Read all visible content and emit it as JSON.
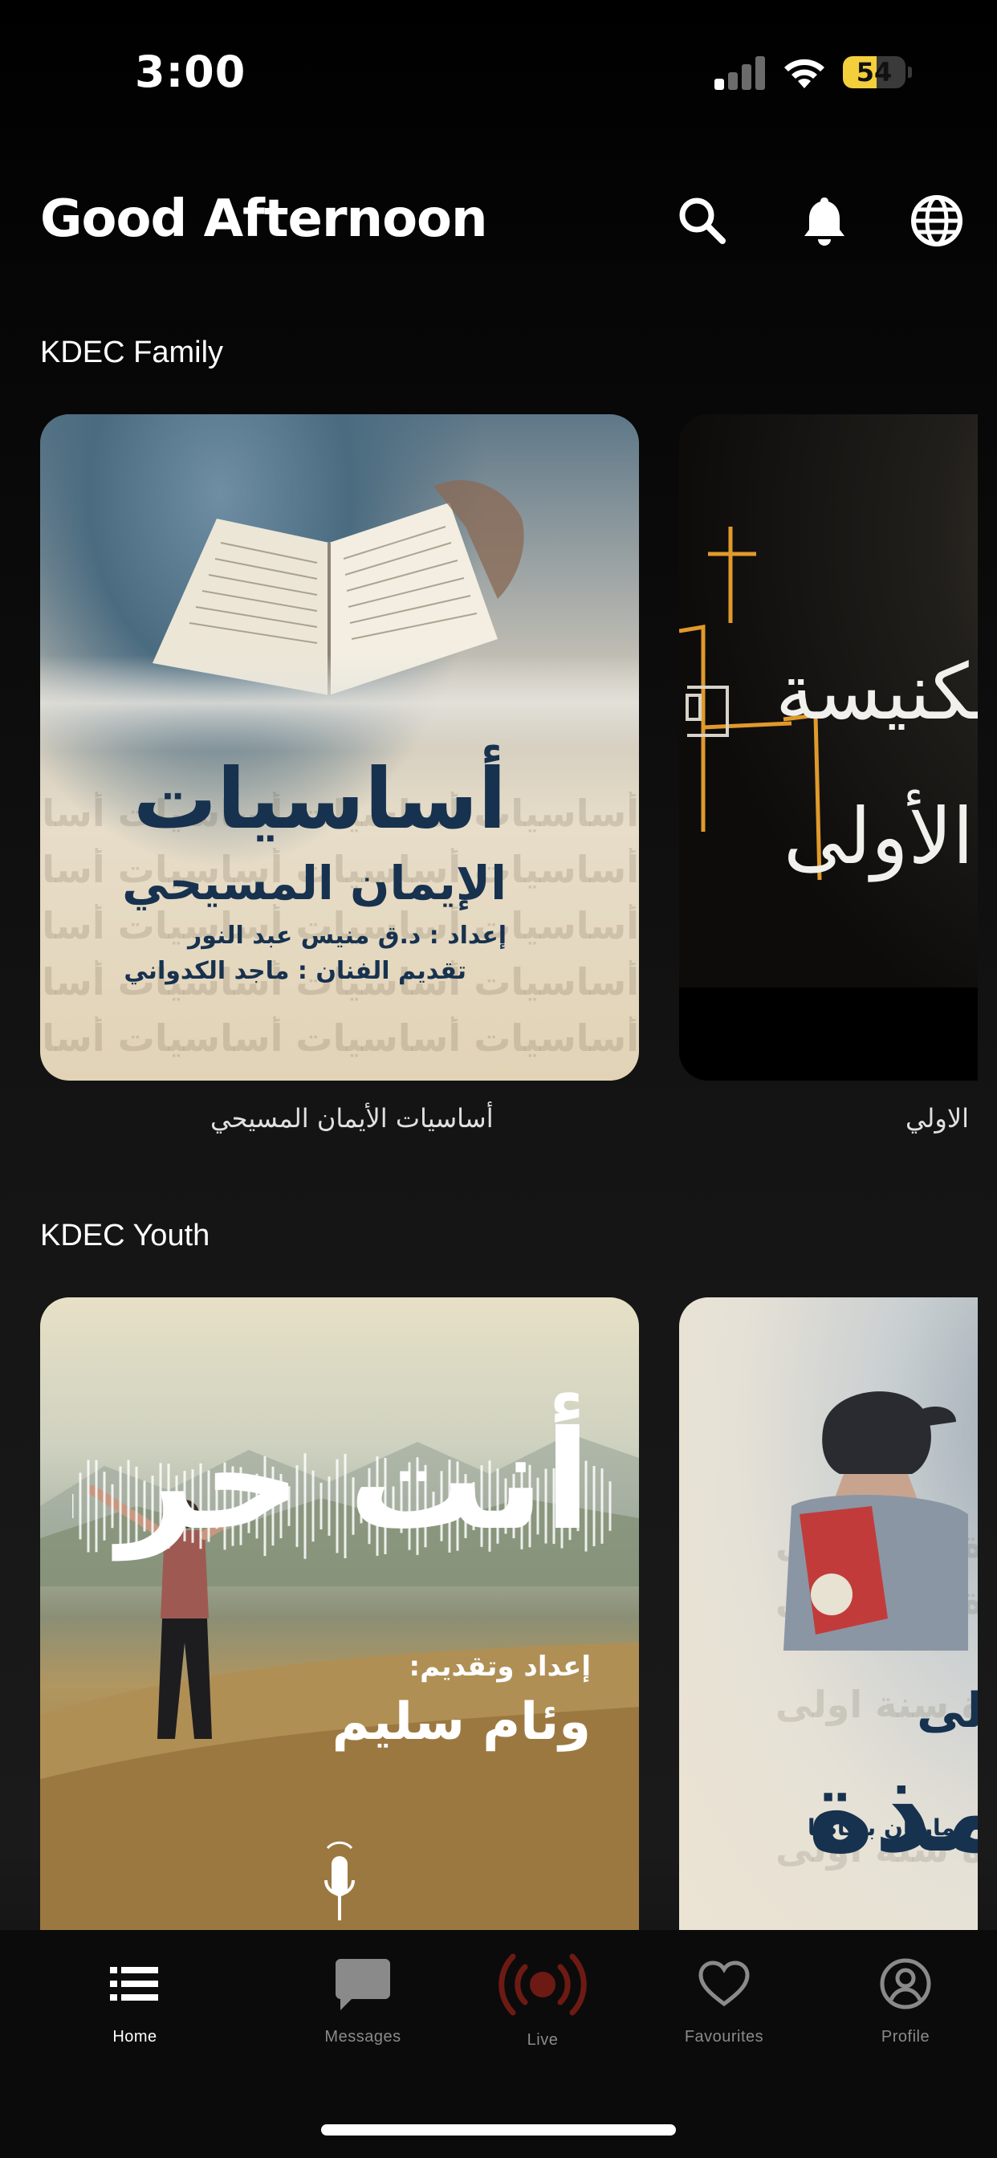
{
  "status_bar": {
    "time": "3:00",
    "battery_percent": "54",
    "battery_level": 0.54,
    "battery_color": "#f4cf3c"
  },
  "header": {
    "greeting": "Good Afternoon"
  },
  "sections": [
    {
      "title": "KDEC Family",
      "cards": [
        {
          "caption": "أساسيات الأيمان المسيحي",
          "art_title": "أساسيات",
          "art_subtitle": "الإيمان المسيحي",
          "art_credit1": "إعداد : د.ق منيس عبد النور",
          "art_credit2": "تقديم الفنان : ماجد الكدواني",
          "watermark": "أساسيات أساسيات أساسيات أساسيات"
        },
        {
          "caption": "الكنيسة الاولي",
          "art_title": "الكنيسة",
          "art_subtitle": "الأولى"
        }
      ]
    },
    {
      "title": "KDEC Youth",
      "cards": [
        {
          "art_title": "أنت حر",
          "art_credit_label": "إعداد وتقديم:",
          "art_credit_name": "وئام سليم"
        },
        {
          "art_title": "تلمذة",
          "art_line": "سنة أولى",
          "art_credit": "تقديم : ماريان بطاطا",
          "watermark": "تلمذة تلمذة تلمذة سنة اولى"
        }
      ]
    }
  ],
  "tabbar": {
    "tabs": [
      {
        "label": "Home",
        "icon": "list-icon",
        "active": true
      },
      {
        "label": "Messages",
        "icon": "message-icon",
        "active": false
      },
      {
        "label": "Live",
        "icon": "broadcast-icon",
        "active": false
      },
      {
        "label": "Favourites",
        "icon": "heart-icon",
        "active": false
      },
      {
        "label": "Profile",
        "icon": "profile-icon",
        "active": false
      }
    ]
  },
  "colors": {
    "background": "#000000",
    "live_accent": "#6e1a14",
    "art_navy": "#17324f"
  }
}
